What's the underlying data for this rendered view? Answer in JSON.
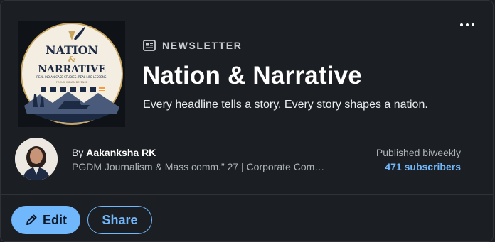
{
  "newsletter": {
    "kicker": "NEWSLETTER",
    "title": "Nation & Narrative",
    "tagline": "Every headline tells a story. Every story shapes a nation.",
    "logo": {
      "line1": "NATION",
      "amp": "&",
      "line2": "NARRATIVE",
      "subtitle": "REAL INDIAN CASE STUDIES. REAL LIFE LESSONS.",
      "footer": "FOCUS: INDIAN DEFENCE"
    }
  },
  "author": {
    "by": "By ",
    "name": "Aakanksha RK",
    "bio": "PGDM Journalism & Mass comm.” 27 | Corporate Com…"
  },
  "meta": {
    "frequency": "Published biweekly",
    "subscribers": "471 subscribers"
  },
  "actions": {
    "edit": "Edit",
    "share": "Share"
  },
  "colors": {
    "background": "#1b1f23",
    "accent": "#71b7fb",
    "muted_text": "#aeb4ba"
  },
  "icons": {
    "more": "more-horizontal-icon",
    "newsletter": "newsletter-icon",
    "edit": "pencil-icon"
  }
}
